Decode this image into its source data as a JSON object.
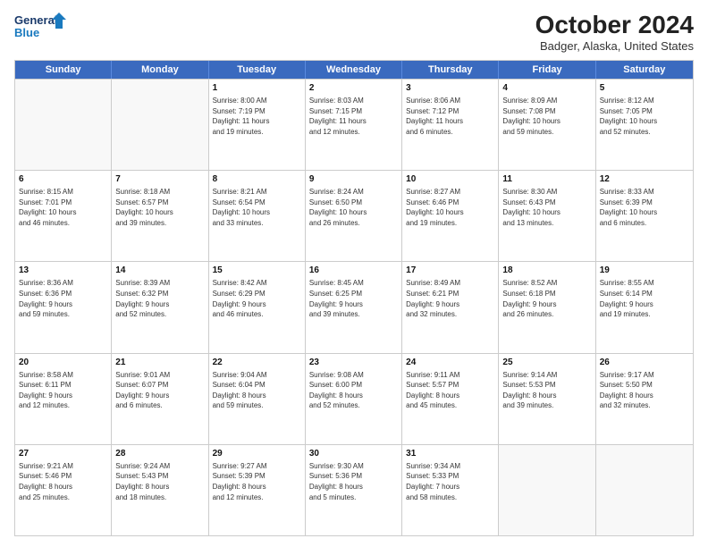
{
  "header": {
    "logo_line1": "General",
    "logo_line2": "Blue",
    "title": "October 2024",
    "location": "Badger, Alaska, United States"
  },
  "days_of_week": [
    "Sunday",
    "Monday",
    "Tuesday",
    "Wednesday",
    "Thursday",
    "Friday",
    "Saturday"
  ],
  "weeks": [
    [
      {
        "day": "",
        "text": ""
      },
      {
        "day": "",
        "text": ""
      },
      {
        "day": "1",
        "text": "Sunrise: 8:00 AM\nSunset: 7:19 PM\nDaylight: 11 hours\nand 19 minutes."
      },
      {
        "day": "2",
        "text": "Sunrise: 8:03 AM\nSunset: 7:15 PM\nDaylight: 11 hours\nand 12 minutes."
      },
      {
        "day": "3",
        "text": "Sunrise: 8:06 AM\nSunset: 7:12 PM\nDaylight: 11 hours\nand 6 minutes."
      },
      {
        "day": "4",
        "text": "Sunrise: 8:09 AM\nSunset: 7:08 PM\nDaylight: 10 hours\nand 59 minutes."
      },
      {
        "day": "5",
        "text": "Sunrise: 8:12 AM\nSunset: 7:05 PM\nDaylight: 10 hours\nand 52 minutes."
      }
    ],
    [
      {
        "day": "6",
        "text": "Sunrise: 8:15 AM\nSunset: 7:01 PM\nDaylight: 10 hours\nand 46 minutes."
      },
      {
        "day": "7",
        "text": "Sunrise: 8:18 AM\nSunset: 6:57 PM\nDaylight: 10 hours\nand 39 minutes."
      },
      {
        "day": "8",
        "text": "Sunrise: 8:21 AM\nSunset: 6:54 PM\nDaylight: 10 hours\nand 33 minutes."
      },
      {
        "day": "9",
        "text": "Sunrise: 8:24 AM\nSunset: 6:50 PM\nDaylight: 10 hours\nand 26 minutes."
      },
      {
        "day": "10",
        "text": "Sunrise: 8:27 AM\nSunset: 6:46 PM\nDaylight: 10 hours\nand 19 minutes."
      },
      {
        "day": "11",
        "text": "Sunrise: 8:30 AM\nSunset: 6:43 PM\nDaylight: 10 hours\nand 13 minutes."
      },
      {
        "day": "12",
        "text": "Sunrise: 8:33 AM\nSunset: 6:39 PM\nDaylight: 10 hours\nand 6 minutes."
      }
    ],
    [
      {
        "day": "13",
        "text": "Sunrise: 8:36 AM\nSunset: 6:36 PM\nDaylight: 9 hours\nand 59 minutes."
      },
      {
        "day": "14",
        "text": "Sunrise: 8:39 AM\nSunset: 6:32 PM\nDaylight: 9 hours\nand 52 minutes."
      },
      {
        "day": "15",
        "text": "Sunrise: 8:42 AM\nSunset: 6:29 PM\nDaylight: 9 hours\nand 46 minutes."
      },
      {
        "day": "16",
        "text": "Sunrise: 8:45 AM\nSunset: 6:25 PM\nDaylight: 9 hours\nand 39 minutes."
      },
      {
        "day": "17",
        "text": "Sunrise: 8:49 AM\nSunset: 6:21 PM\nDaylight: 9 hours\nand 32 minutes."
      },
      {
        "day": "18",
        "text": "Sunrise: 8:52 AM\nSunset: 6:18 PM\nDaylight: 9 hours\nand 26 minutes."
      },
      {
        "day": "19",
        "text": "Sunrise: 8:55 AM\nSunset: 6:14 PM\nDaylight: 9 hours\nand 19 minutes."
      }
    ],
    [
      {
        "day": "20",
        "text": "Sunrise: 8:58 AM\nSunset: 6:11 PM\nDaylight: 9 hours\nand 12 minutes."
      },
      {
        "day": "21",
        "text": "Sunrise: 9:01 AM\nSunset: 6:07 PM\nDaylight: 9 hours\nand 6 minutes."
      },
      {
        "day": "22",
        "text": "Sunrise: 9:04 AM\nSunset: 6:04 PM\nDaylight: 8 hours\nand 59 minutes."
      },
      {
        "day": "23",
        "text": "Sunrise: 9:08 AM\nSunset: 6:00 PM\nDaylight: 8 hours\nand 52 minutes."
      },
      {
        "day": "24",
        "text": "Sunrise: 9:11 AM\nSunset: 5:57 PM\nDaylight: 8 hours\nand 45 minutes."
      },
      {
        "day": "25",
        "text": "Sunrise: 9:14 AM\nSunset: 5:53 PM\nDaylight: 8 hours\nand 39 minutes."
      },
      {
        "day": "26",
        "text": "Sunrise: 9:17 AM\nSunset: 5:50 PM\nDaylight: 8 hours\nand 32 minutes."
      }
    ],
    [
      {
        "day": "27",
        "text": "Sunrise: 9:21 AM\nSunset: 5:46 PM\nDaylight: 8 hours\nand 25 minutes."
      },
      {
        "day": "28",
        "text": "Sunrise: 9:24 AM\nSunset: 5:43 PM\nDaylight: 8 hours\nand 18 minutes."
      },
      {
        "day": "29",
        "text": "Sunrise: 9:27 AM\nSunset: 5:39 PM\nDaylight: 8 hours\nand 12 minutes."
      },
      {
        "day": "30",
        "text": "Sunrise: 9:30 AM\nSunset: 5:36 PM\nDaylight: 8 hours\nand 5 minutes."
      },
      {
        "day": "31",
        "text": "Sunrise: 9:34 AM\nSunset: 5:33 PM\nDaylight: 7 hours\nand 58 minutes."
      },
      {
        "day": "",
        "text": ""
      },
      {
        "day": "",
        "text": ""
      }
    ]
  ]
}
